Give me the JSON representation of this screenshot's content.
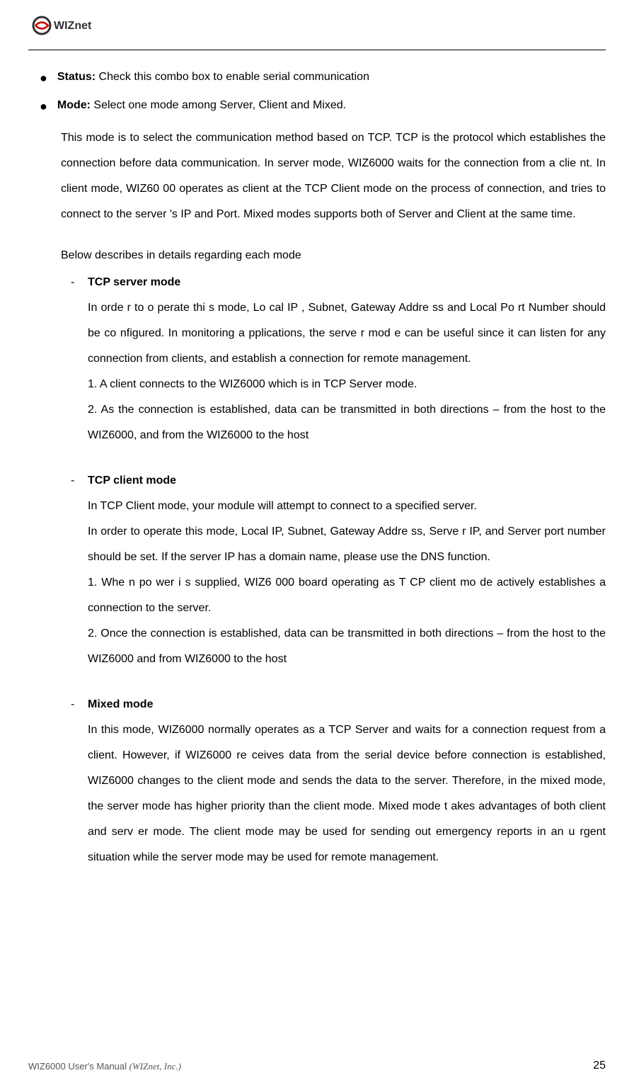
{
  "logo": {
    "name": "WIZnet"
  },
  "bullets": {
    "status_label": "Status:",
    "status_text": " Check this combo box to enable serial communication",
    "mode_label": "Mode:",
    "mode_text": " Select one mode among Server, Client and Mixed."
  },
  "mode_body": {
    "para1": "This mode is to select the communication method based on TCP. TCP is the protocol which establishes the connection before data communication. In server mode, WIZ6000 waits for the connection from a clie nt. In client mode, WIZ60 00 operates as client at the TCP Client mode on the process of connection, and tries to connect to the server 's IP and Port. Mixed modes supports both of Server and Client at the same time.",
    "intro": "Below describes in details regarding each mode"
  },
  "tcp_server": {
    "title": "TCP server mode",
    "body": "In orde r to o perate thi s mode, Lo cal IP , Subnet, Gateway Addre ss and Local Po rt Number should be co nfigured. In monitoring a pplications, the serve r mod e can be useful since it can listen for any connection from clients, and establish a connection for remote management.\n1. A client connects to the WIZ6000 which is in TCP Server mode.\n2. As the connection is established, data can be transmitted in both directions – from the host to the WIZ6000, and from the WIZ6000 to the host"
  },
  "tcp_client": {
    "title": "TCP client mode",
    "body": "In TCP Client mode, your module will attempt to connect to a specified server.\nIn order to operate this mode, Local IP, Subnet, Gateway Addre ss, Serve r IP, and Server port number should be set. If the server IP has a domain name, please use the DNS function.\n1. Whe n po wer i s supplied, WIZ6 000 board operating as T CP client mo de actively establishes a connection to the server.\n2. Once the connection is established, data can be transmitted in both directions – from the host to the WIZ6000 and from WIZ6000 to the host"
  },
  "mixed": {
    "title": "Mixed mode",
    "body": "In this mode, WIZ6000 normally operates as a TCP Server and waits for a connection request from a client. However, if WIZ6000 re ceives data from the serial device before connection is established, WIZ6000 changes to the client mode and sends the data to the server. Therefore, in the mixed mode, the server mode has higher priority than the client mode. Mixed mode t akes advantages of both client and serv er mode. The client mode may be used for sending out emergency reports in an u rgent situation while the server mode may be used for remote management."
  },
  "footer": {
    "left_plain": "WIZ6000 User's Manual ",
    "left_italic": "(WIZnet, Inc.)",
    "page": "25"
  }
}
